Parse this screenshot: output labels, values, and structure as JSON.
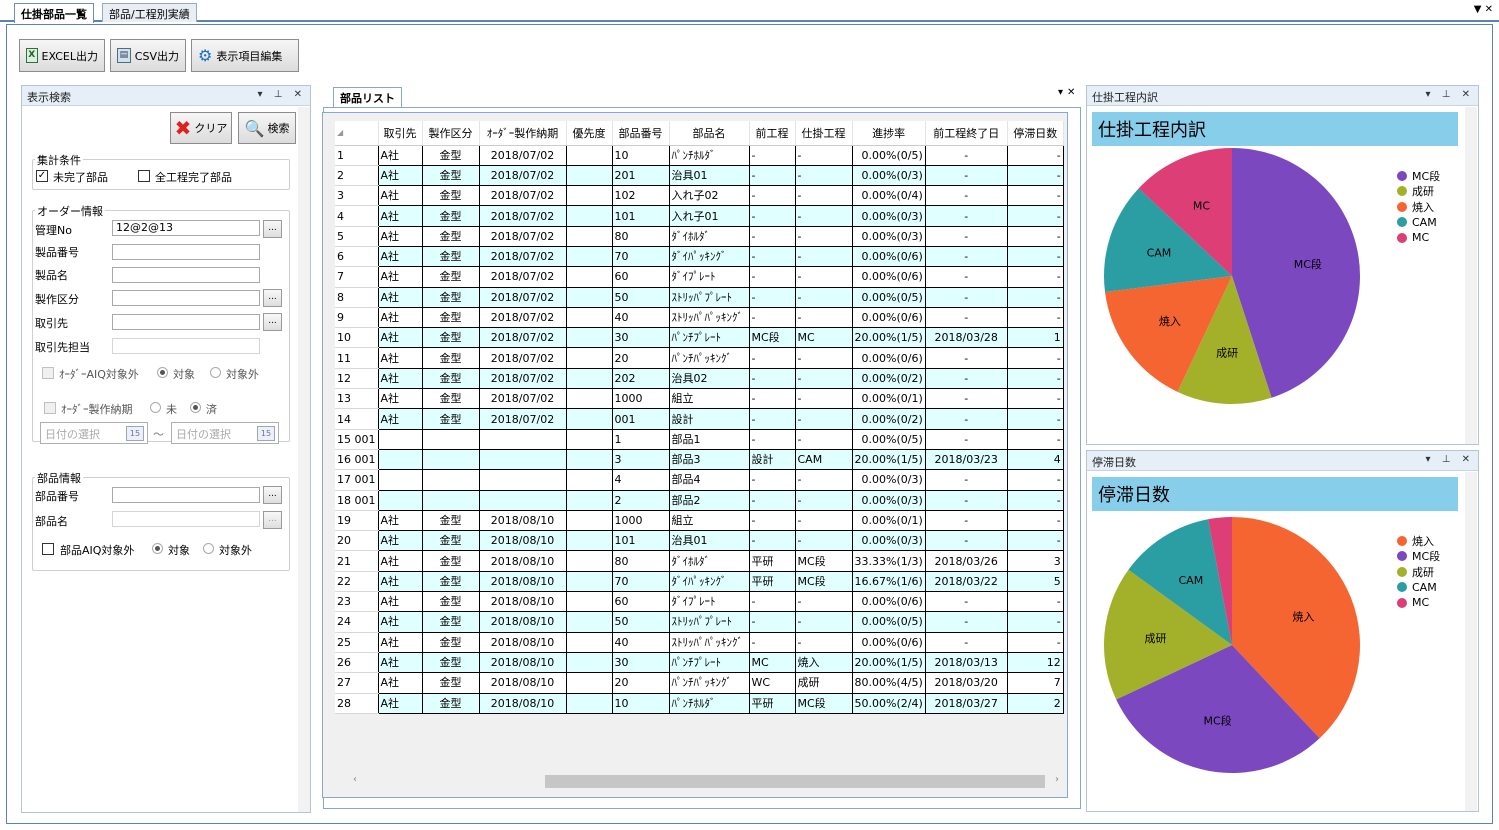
{
  "tabs": [
    {
      "label": "仕掛部品一覧"
    },
    {
      "label": "部品/工程別実績"
    }
  ],
  "toolbar": {
    "excel": "EXCEL出力",
    "csv": "CSV出力",
    "edit": "表示項目編集"
  },
  "search": {
    "title": "表示検索",
    "clear": "クリア",
    "search": "検索",
    "agg_title": "集計条件",
    "agg_opt1": "未完了部品",
    "agg_opt2": "全工程完了部品",
    "order_title": "オーダー情報",
    "fields": [
      {
        "label": "管理No",
        "value": "12@2@13"
      },
      {
        "label": "製品番号",
        "value": ""
      },
      {
        "label": "製品名",
        "value": ""
      },
      {
        "label": "製作区分",
        "value": ""
      },
      {
        "label": "取引先",
        "value": ""
      },
      {
        "label": "取引先担当",
        "value": ""
      }
    ],
    "aiq": "ｵｰﾀﾞｰAIQ対象外",
    "target": "対象",
    "nontarget": "対象外",
    "due": "ｵｰﾀﾞｰ製作納期",
    "not_yet": "未",
    "done": "済",
    "date_placeholder": "日付の選択",
    "tilde": "〜",
    "ellipsis": "...",
    "cal": "15",
    "part_title": "部品情報",
    "part_no": "部品番号",
    "part_name": "部品名",
    "part_aiq": "部品AIQ対象外",
    "part_target": "対象",
    "part_nontarget": "対象外"
  },
  "grid": {
    "title": "部品リスト",
    "columns": [
      "取引先",
      "製作区分",
      "ｵｰﾀﾞｰ製作納期",
      "優先度",
      "部品番号",
      "部品名",
      "前工程",
      "仕掛工程",
      "進捗率",
      "前工程終了日",
      "停滞日数"
    ],
    "rows": [
      [
        "1",
        "A社",
        "金型",
        "2018/07/02",
        "",
        "10",
        "ﾊﾟﾝﾁﾎﾙﾀﾞ",
        "-",
        "-",
        "0.00%(0/5)",
        "-",
        "-"
      ],
      [
        "2",
        "A社",
        "金型",
        "2018/07/02",
        "",
        "201",
        "治具01",
        "-",
        "-",
        "0.00%(0/3)",
        "-",
        "-"
      ],
      [
        "3",
        "A社",
        "金型",
        "2018/07/02",
        "",
        "102",
        "入れ子02",
        "-",
        "-",
        "0.00%(0/4)",
        "-",
        "-"
      ],
      [
        "4",
        "A社",
        "金型",
        "2018/07/02",
        "",
        "101",
        "入れ子01",
        "-",
        "-",
        "0.00%(0/3)",
        "-",
        "-"
      ],
      [
        "5",
        "A社",
        "金型",
        "2018/07/02",
        "",
        "80",
        "ﾀﾞｲﾎﾙﾀﾞ",
        "-",
        "-",
        "0.00%(0/3)",
        "-",
        "-"
      ],
      [
        "6",
        "A社",
        "金型",
        "2018/07/02",
        "",
        "70",
        "ﾀﾞｲﾊﾟｯｷﾝｸﾞ",
        "-",
        "-",
        "0.00%(0/6)",
        "-",
        "-"
      ],
      [
        "7",
        "A社",
        "金型",
        "2018/07/02",
        "",
        "60",
        "ﾀﾞｲﾌﾟﾚｰﾄ",
        "-",
        "-",
        "0.00%(0/6)",
        "-",
        "-"
      ],
      [
        "8",
        "A社",
        "金型",
        "2018/07/02",
        "",
        "50",
        "ｽﾄﾘｯﾊﾟﾌﾟﾚｰﾄ",
        "-",
        "-",
        "0.00%(0/5)",
        "-",
        "-"
      ],
      [
        "9",
        "A社",
        "金型",
        "2018/07/02",
        "",
        "40",
        "ｽﾄﾘｯﾊﾟﾊﾟｯｷﾝｸﾞ",
        "-",
        "-",
        "0.00%(0/6)",
        "-",
        "-"
      ],
      [
        "10",
        "A社",
        "金型",
        "2018/07/02",
        "",
        "30",
        "ﾊﾟﾝﾁﾌﾟﾚｰﾄ",
        "MC段",
        "MC",
        "20.00%(1/5)",
        "2018/03/28",
        "1"
      ],
      [
        "11",
        "A社",
        "金型",
        "2018/07/02",
        "",
        "20",
        "ﾊﾟﾝﾁﾊﾟｯｷﾝｸﾞ",
        "-",
        "-",
        "0.00%(0/6)",
        "-",
        "-"
      ],
      [
        "12",
        "A社",
        "金型",
        "2018/07/02",
        "",
        "202",
        "治具02",
        "-",
        "-",
        "0.00%(0/2)",
        "-",
        "-"
      ],
      [
        "13",
        "A社",
        "金型",
        "2018/07/02",
        "",
        "1000",
        "組立",
        "-",
        "-",
        "0.00%(0/1)",
        "-",
        "-"
      ],
      [
        "14",
        "A社",
        "金型",
        "2018/07/02",
        "",
        "001",
        "設計",
        "-",
        "-",
        "0.00%(0/2)",
        "-",
        "-"
      ],
      [
        "15 001",
        "",
        "",
        "",
        "",
        "1",
        "部品1",
        "-",
        "-",
        "0.00%(0/5)",
        "-",
        "-"
      ],
      [
        "16 001",
        "",
        "",
        "",
        "",
        "3",
        "部品3",
        "設計",
        "CAM",
        "20.00%(1/5)",
        "2018/03/23",
        "4"
      ],
      [
        "17 001",
        "",
        "",
        "",
        "",
        "4",
        "部品4",
        "-",
        "-",
        "0.00%(0/3)",
        "-",
        "-"
      ],
      [
        "18 001",
        "",
        "",
        "",
        "",
        "2",
        "部品2",
        "-",
        "-",
        "0.00%(0/3)",
        "-",
        "-"
      ],
      [
        "19",
        "A社",
        "金型",
        "2018/08/10",
        "",
        "1000",
        "組立",
        "-",
        "-",
        "0.00%(0/1)",
        "-",
        "-"
      ],
      [
        "20",
        "A社",
        "金型",
        "2018/08/10",
        "",
        "101",
        "治具01",
        "-",
        "-",
        "0.00%(0/3)",
        "-",
        "-"
      ],
      [
        "21",
        "A社",
        "金型",
        "2018/08/10",
        "",
        "80",
        "ﾀﾞｲﾎﾙﾀﾞ",
        "平研",
        "MC段",
        "33.33%(1/3)",
        "2018/03/26",
        "3"
      ],
      [
        "22",
        "A社",
        "金型",
        "2018/08/10",
        "",
        "70",
        "ﾀﾞｲﾊﾟｯｷﾝｸﾞ",
        "平研",
        "MC段",
        "16.67%(1/6)",
        "2018/03/22",
        "5"
      ],
      [
        "23",
        "A社",
        "金型",
        "2018/08/10",
        "",
        "60",
        "ﾀﾞｲﾌﾟﾚｰﾄ",
        "-",
        "-",
        "0.00%(0/6)",
        "-",
        "-"
      ],
      [
        "24",
        "A社",
        "金型",
        "2018/08/10",
        "",
        "50",
        "ｽﾄﾘｯﾊﾟﾌﾟﾚｰﾄ",
        "-",
        "-",
        "0.00%(0/5)",
        "-",
        "-"
      ],
      [
        "25",
        "A社",
        "金型",
        "2018/08/10",
        "",
        "40",
        "ｽﾄﾘｯﾊﾟﾊﾟｯｷﾝｸﾞ",
        "-",
        "-",
        "0.00%(0/6)",
        "-",
        "-"
      ],
      [
        "26",
        "A社",
        "金型",
        "2018/08/10",
        "",
        "30",
        "ﾊﾟﾝﾁﾌﾟﾚｰﾄ",
        "MC",
        "焼入",
        "20.00%(1/5)",
        "2018/03/13",
        "12"
      ],
      [
        "27",
        "A社",
        "金型",
        "2018/08/10",
        "",
        "20",
        "ﾊﾟﾝﾁﾊﾟｯｷﾝｸﾞ",
        "WC",
        "成研",
        "80.00%(4/5)",
        "2018/03/20",
        "7"
      ],
      [
        "28",
        "A社",
        "金型",
        "2018/08/10",
        "",
        "10",
        "ﾊﾟﾝﾁﾎﾙﾀﾞ",
        "平研",
        "MC段",
        "50.00%(2/4)",
        "2018/03/27",
        "2"
      ]
    ]
  },
  "colors": {
    "MC段": "#7b48c0",
    "成研": "#a3b12a",
    "焼入": "#f46531",
    "CAM": "#2a9ea3",
    "MC": "#dc3e75",
    "banner": "#87ceeb",
    "even_row": "#e0ffff"
  },
  "chart_data": [
    {
      "type": "pie",
      "panel": "仕掛工程内訳",
      "title": "仕掛工程内訳",
      "labels": [
        "MC段",
        "成研",
        "焼入",
        "CAM",
        "MC"
      ],
      "values": [
        45,
        12,
        16,
        14,
        13
      ],
      "legend": "right"
    },
    {
      "type": "pie",
      "panel": "停滞日数",
      "title": "停滞日数",
      "labels": [
        "焼入",
        "MC段",
        "成研",
        "CAM",
        "MC"
      ],
      "values": [
        38,
        30,
        17,
        12,
        3
      ],
      "legend": "right"
    }
  ]
}
